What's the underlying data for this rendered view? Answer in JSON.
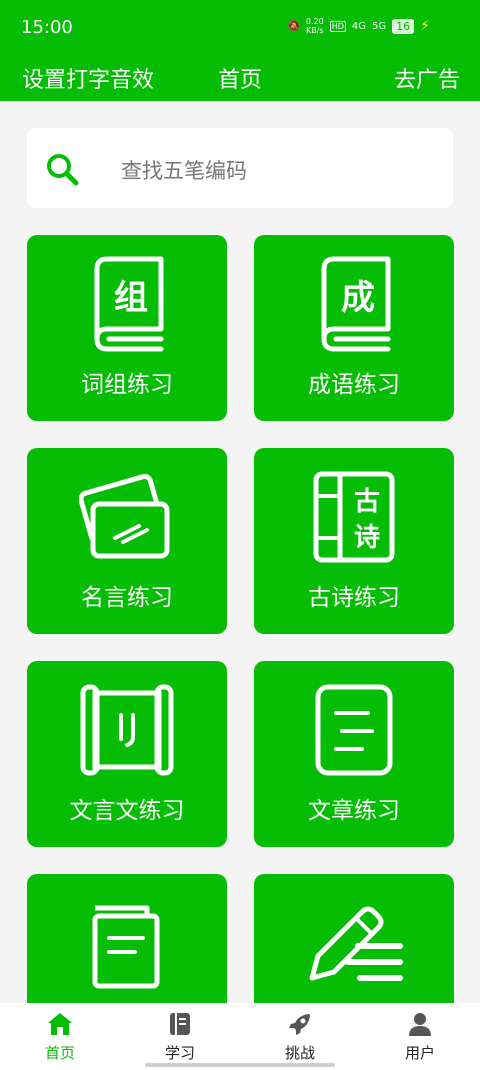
{
  "status": {
    "time": "15:00",
    "net_speed": "0.20",
    "net_unit": "KB/s",
    "hd": "HD",
    "sig1": "4G",
    "sig2": "5G",
    "battery": "16"
  },
  "appbar": {
    "left": "设置打字音效",
    "center": "首页",
    "right": "去广告"
  },
  "search": {
    "placeholder": "查找五笔编码"
  },
  "cards": {
    "c1": {
      "label": "词组练习",
      "icon_char": "组"
    },
    "c2": {
      "label": "成语练习",
      "icon_char": "成"
    },
    "c3": {
      "label": "名言练习"
    },
    "c4": {
      "label": "古诗练习",
      "icon_char1": "古",
      "icon_char2": "诗"
    },
    "c5": {
      "label": "文言文练习"
    },
    "c6": {
      "label": "文章练习"
    },
    "c7": {
      "label": ""
    },
    "c8": {
      "label": ""
    }
  },
  "nav": {
    "home": "首页",
    "study": "学习",
    "challenge": "挑战",
    "user": "用户"
  },
  "colors": {
    "accent": "#06bd06",
    "background": "#f4f4f4"
  }
}
